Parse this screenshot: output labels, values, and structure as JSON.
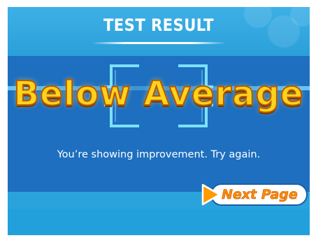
{
  "header": {
    "title": "TEST RESULT"
  },
  "result": {
    "grade": "Below Average",
    "message": "You’re showing improvement. Try again."
  },
  "navigation": {
    "next_label": "Next Page",
    "next_icon": "play-arrow-icon"
  },
  "colors": {
    "sky_blue": "#2aa3dd",
    "panel_blue": "#1e6fbf",
    "grade_yellow": "#ffd21c",
    "grade_outline": "#b65a00",
    "next_orange": "#ff8a00"
  }
}
